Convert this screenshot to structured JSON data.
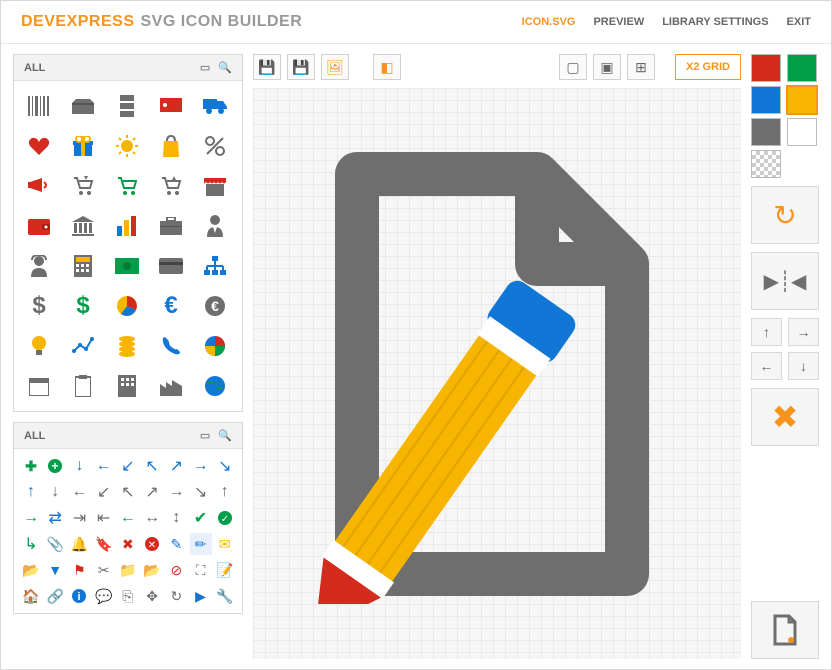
{
  "brand": {
    "name": "DEVEXPRESS",
    "sub": "SVG ICON BUILDER"
  },
  "nav": {
    "iconsvg": "ICON.SVG",
    "preview": "PREVIEW",
    "library": "LIBRARY SETTINGS",
    "exit": "EXIT"
  },
  "panel1": {
    "title": "ALL"
  },
  "panel2": {
    "title": "ALL"
  },
  "gridLabel": "X2 GRID",
  "colors": {
    "red": "#d52b1e",
    "green": "#039e49",
    "blue": "#1177d7",
    "yellow": "#f7b500",
    "gray": "#6e6e6e",
    "white": "#ffffff"
  },
  "canvas_icon": {
    "type": "document-with-pencil",
    "document_color": "#6e6e6e",
    "pencil_body": "#f7b500",
    "pencil_eraser": "#1177d7",
    "pencil_tip": "#d52b1e",
    "pencil_band": "#ffffff"
  }
}
